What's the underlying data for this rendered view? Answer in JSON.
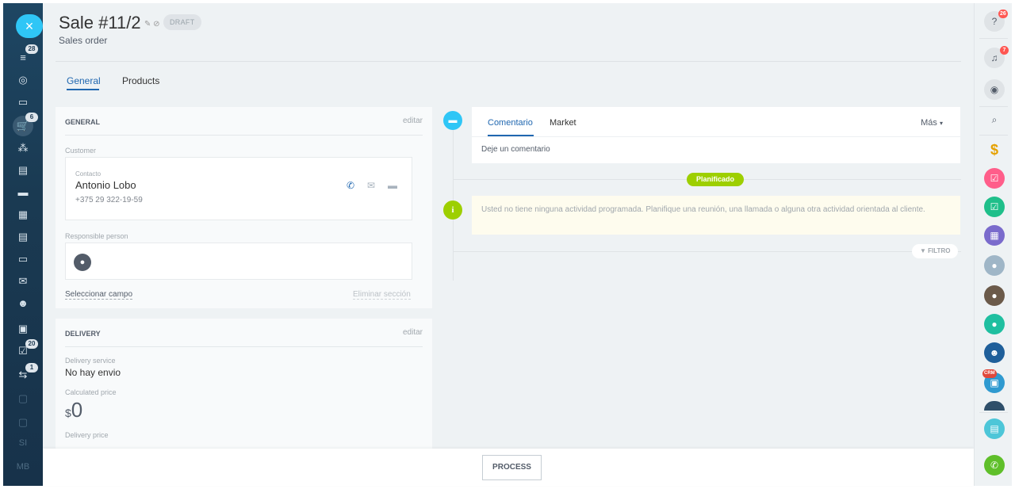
{
  "sidebar_left": {
    "close_glyph": "×",
    "items": [
      {
        "icon": "filter-icon",
        "glyph": "≡",
        "badge": "28"
      },
      {
        "icon": "target-icon",
        "glyph": "◎",
        "badge": ""
      },
      {
        "icon": "window-icon",
        "glyph": "▭",
        "badge": ""
      },
      {
        "icon": "cart-icon",
        "glyph": "🛒",
        "badge": "6"
      },
      {
        "icon": "share-icon",
        "glyph": "⁂",
        "badge": ""
      },
      {
        "icon": "card-icon",
        "glyph": "▤",
        "badge": ""
      },
      {
        "icon": "chat-icon",
        "glyph": "▬",
        "badge": ""
      },
      {
        "icon": "calendar-icon",
        "glyph": "▦",
        "badge": ""
      },
      {
        "icon": "document-icon",
        "glyph": "▤",
        "badge": ""
      },
      {
        "icon": "drive-icon",
        "glyph": "▭",
        "badge": ""
      },
      {
        "icon": "mail-icon",
        "glyph": "✉",
        "badge": ""
      },
      {
        "icon": "group-icon",
        "glyph": "☻",
        "badge": ""
      },
      {
        "icon": "contact-card-icon",
        "glyph": "▣",
        "badge": ""
      },
      {
        "icon": "tasks-icon",
        "glyph": "☑",
        "badge": "20"
      },
      {
        "icon": "flow-icon",
        "glyph": "⇆",
        "badge": "1"
      },
      {
        "icon": "box-icon",
        "glyph": "▢",
        "badge": ""
      },
      {
        "icon": "box2-icon",
        "glyph": "▢",
        "badge": ""
      }
    ],
    "text_items": [
      "SI",
      "MB"
    ]
  },
  "header": {
    "title": "Sale  #11/2",
    "status_badge": "DRAFT",
    "subtitle": "Sales order"
  },
  "tabs": [
    {
      "label": "General",
      "active": true
    },
    {
      "label": "Products",
      "active": false
    }
  ],
  "general_card": {
    "heading": "GENERAL",
    "edit_label": "editar",
    "customer_label": "Customer",
    "contact_label": "Contacto",
    "contact_name": "Antonio Lobo",
    "contact_phone": "+375 29 322-19-59",
    "responsible_label": "Responsible person",
    "select_field": "Seleccionar campo",
    "delete_section": "Eliminar sección"
  },
  "delivery_card": {
    "heading": "DELIVERY",
    "edit_label": "editar",
    "service_label": "Delivery service",
    "service_value": "No hay envio",
    "calc_price_label": "Calculated price",
    "calc_price_currency": "$",
    "calc_price_value": "0",
    "delivery_price_label": "Delivery price"
  },
  "timeline": {
    "comment_tabs": [
      {
        "label": "Comentario",
        "active": true
      },
      {
        "label": "Market",
        "active": false
      }
    ],
    "more_label": "Más",
    "comment_placeholder": "Deje un comentario",
    "planned_label": "Planificado",
    "no_activity_text": "Usted no tiene ninguna actividad programada. Planifique una reunión, una llamada o alguna otra actividad orientada al cliente.",
    "filter_label": "FILTRO"
  },
  "footer": {
    "process_label": "PROCESS"
  },
  "sidebar_right": {
    "help_badge": "26",
    "notify_badge": "7",
    "crm_label": "CRM"
  },
  "colors": {
    "accent": "#2067b0",
    "close_button": "#2fc6f6",
    "planned_green": "#9dcf00",
    "dark_sidebar": "#1c3a52"
  }
}
